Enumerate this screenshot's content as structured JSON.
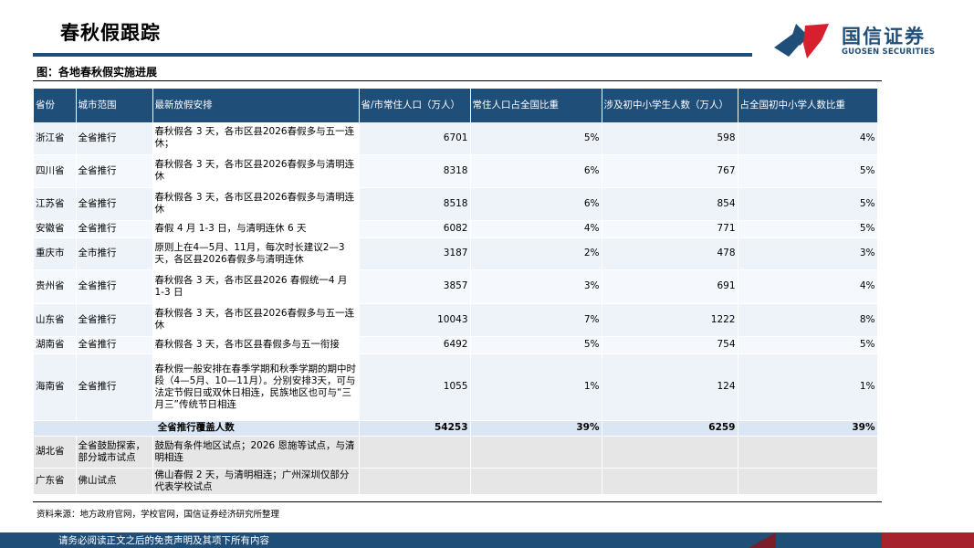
{
  "page_title": "春秋假跟踪",
  "logo": {
    "cn": "国信证券",
    "en": "GUOSEN SECURITIES"
  },
  "figure_caption": "图：各地春秋假实施进展",
  "table": {
    "headers": [
      "省份",
      "城市范围",
      "最新放假安排",
      "省/市常住人口（万人）",
      "常住人口占全国比重",
      "涉及初中小学生人数（万人）",
      "占全国初中小学人数比重"
    ],
    "rows": [
      [
        "浙江省",
        "全省推行",
        "春秋假各 3 天，各市区县2026春假多与五一连休；",
        "6701",
        "5%",
        "598",
        "4%"
      ],
      [
        "四川省",
        "全省推行",
        "春秋假各 3 天，各市区县2026春假多与清明连休",
        "8318",
        "6%",
        "767",
        "5%"
      ],
      [
        "江苏省",
        "全省推行",
        "春秋假各 3 天，各市区县2026春假多与清明连休",
        "8518",
        "6%",
        "854",
        "5%"
      ],
      [
        "安徽省",
        "全省推行",
        "春假 4 月 1-3 日，与清明连休 6 天",
        "6082",
        "4%",
        "771",
        "5%"
      ],
      [
        "重庆市",
        "全市推行",
        "原则上在4—5月、11月，每次时长建议2—3天，各区县2026春假多与清明连休",
        "3187",
        "2%",
        "478",
        "3%"
      ],
      [
        "贵州省",
        "全省推行",
        "春秋假各 3 天，各市区县2026 春假统一4 月1-3 日",
        "3857",
        "3%",
        "691",
        "4%"
      ],
      [
        "山东省",
        "全省推行",
        "春秋假各 3 天，各市区县2026春假多与五一连休",
        "10043",
        "7%",
        "1222",
        "8%"
      ],
      [
        "湖南省",
        "全省推行",
        "春秋假各 3 天，各市区县春假多与五一衔接",
        "6492",
        "5%",
        "754",
        "5%"
      ],
      [
        "海南省",
        "全省推行",
        "春秋假一般安排在春季学期和秋季学期的期中时段（4—5月、10—11月）。分别安排3天，可与法定节假日或双休日相连，民族地区也可与“三月三”传统节日相连",
        "1055",
        "1%",
        "124",
        "1%"
      ]
    ],
    "total": {
      "label": "全省推行覆盖人数",
      "population": "54253",
      "pop_share": "39%",
      "students": "6259",
      "student_share": "39%"
    },
    "trial_rows": [
      [
        "湖北省",
        "全省鼓励探索，部分城市试点",
        "鼓励有条件地区试点；2026 恩施等试点，与清明相连",
        "",
        "",
        "",
        ""
      ],
      [
        "广东省",
        "佛山试点",
        "佛山春假 2 天，与清明相连；广州深圳仅部分代表学校试点",
        "",
        "",
        "",
        ""
      ]
    ]
  },
  "source_note": "资料来源：地方政府官网，学校官网，国信证券经济研究所整理",
  "footer_text": "请务必阅读正文之后的免责声明及其项下所有内容",
  "colors": {
    "primary": "#1f4e79",
    "accent_red": "#d6202e",
    "footer_red": "#a6232d"
  }
}
